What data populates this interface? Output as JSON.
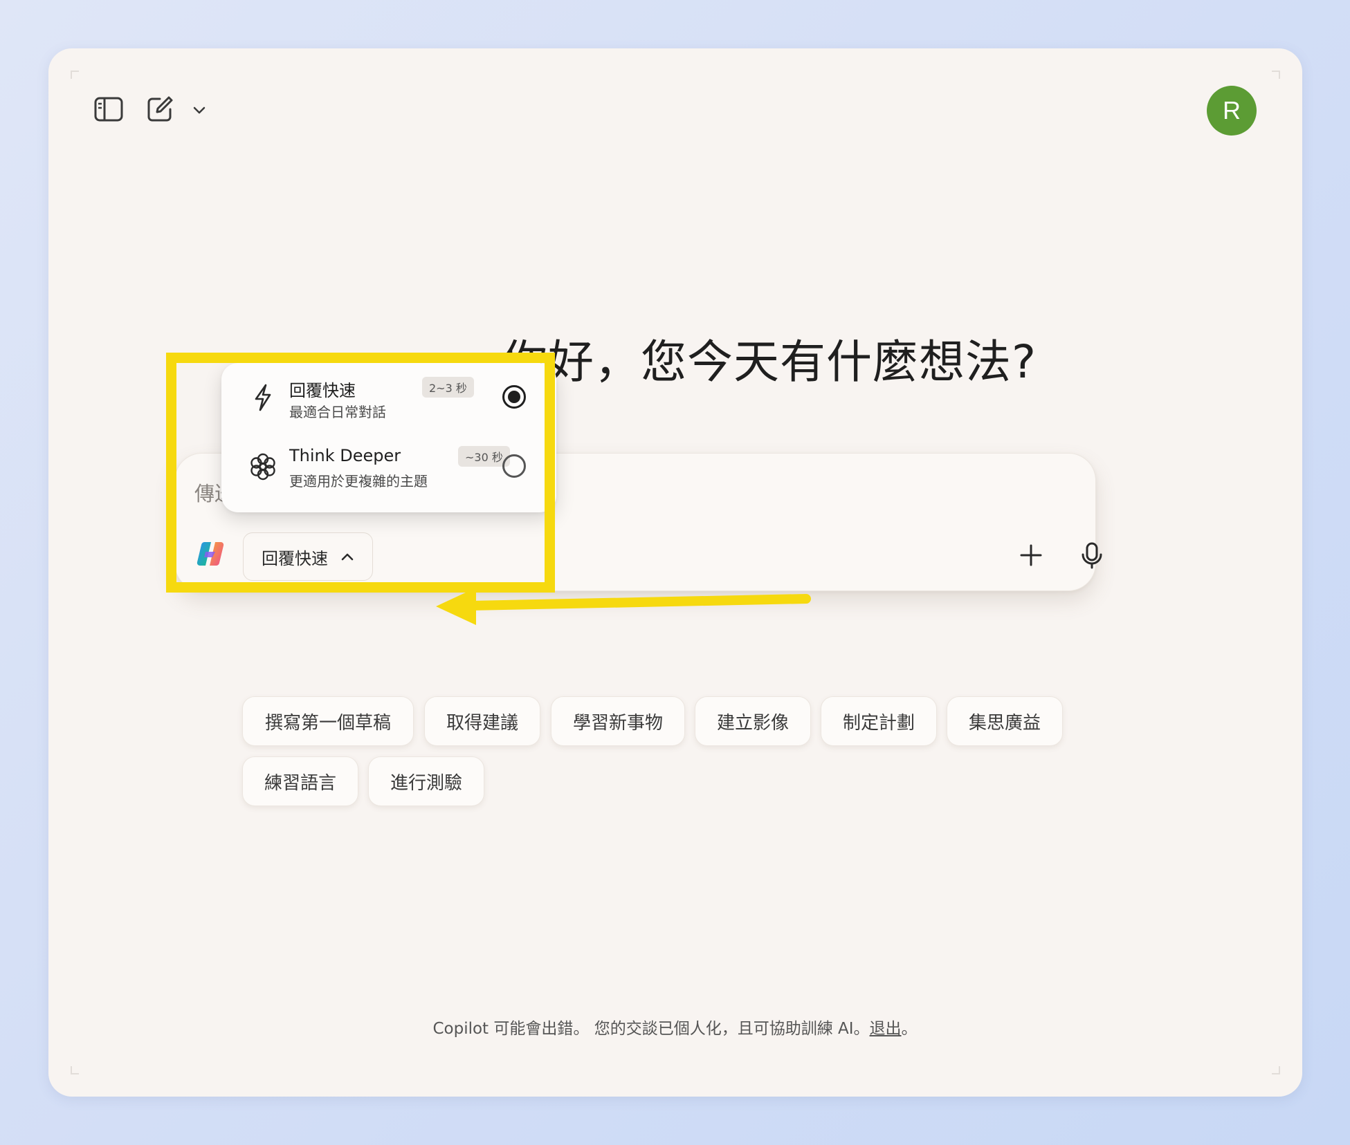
{
  "greeting": "你好，您今天有什麼想法?",
  "composer": {
    "placeholder": "傳送訊息給 Copilot",
    "mode_label": "回覆快速"
  },
  "mode_menu": {
    "options": [
      {
        "title": "回覆快速",
        "badge": "2~3 秒",
        "description": "最適合日常對話",
        "selected": true
      },
      {
        "title": "Think Deeper",
        "badge": "~30 秒",
        "description": "更適用於更複雜的主題",
        "selected": false
      }
    ]
  },
  "avatar": {
    "initial": "R",
    "color": "#5c9c34"
  },
  "suggestions": [
    "撰寫第一個草稿",
    "取得建議",
    "學習新事物",
    "建立影像",
    "制定計劃",
    "集思廣益",
    "練習語言",
    "進行測驗"
  ],
  "footer": {
    "text": "Copilot 可能會出錯。 您的交談已個人化，且可協助訓練 AI。",
    "link": "退出",
    "end": "。"
  },
  "colors": {
    "highlight": "#f6d90f",
    "window_bg": "#f8f4f1"
  },
  "icons": [
    "sidebar-toggle-icon",
    "new-chat-icon",
    "chevron-down-icon",
    "lightning-icon",
    "flower-icon",
    "chevron-up-icon",
    "plus-icon",
    "microphone-icon",
    "copilot-logo"
  ]
}
